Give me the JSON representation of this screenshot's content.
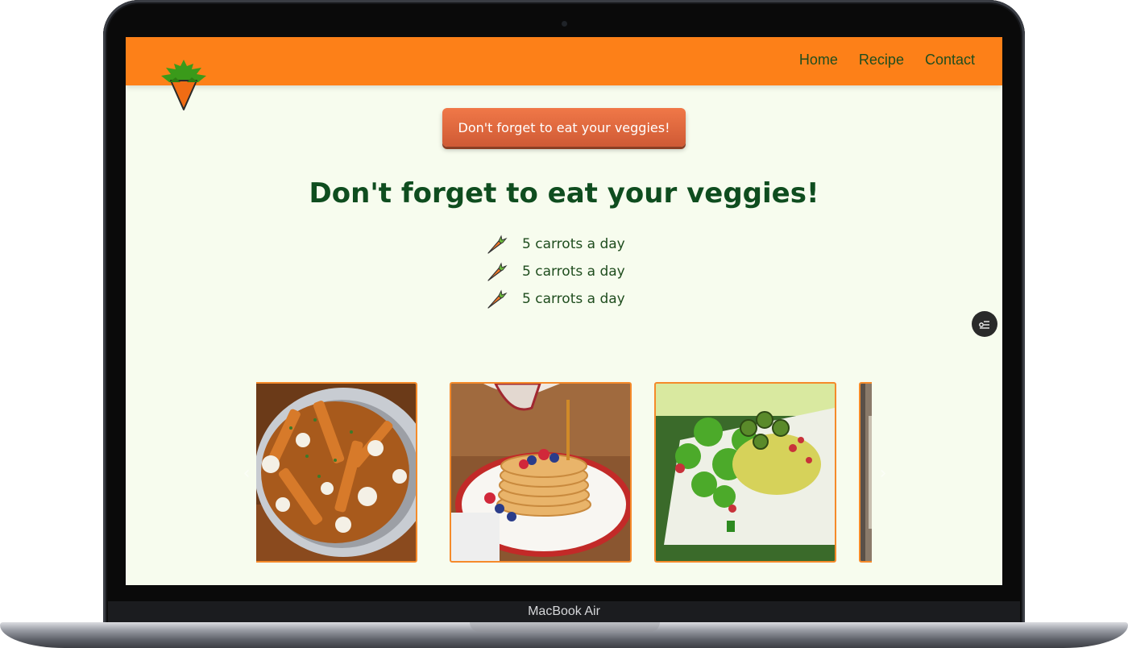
{
  "navbar": {
    "links": [
      {
        "label": "Home"
      },
      {
        "label": "Recipe"
      },
      {
        "label": "Contact"
      }
    ]
  },
  "hero": {
    "button_label": "Don't forget to eat your veggies!",
    "headline": "Don't forget to eat your veggies!",
    "list": [
      {
        "text": "5 carrots a day"
      },
      {
        "text": "5 carrots a day"
      },
      {
        "text": "5 carrots a day"
      }
    ]
  },
  "device": {
    "brand": "MacBook Air"
  },
  "colors": {
    "navbar": "#fd8018",
    "background": "#f7fcee",
    "heading": "#0f4d1f",
    "button": "#e06a3e",
    "card_border": "#f58a2a"
  },
  "icons": {
    "logo": "carrot-logo",
    "list_bullet": "carrot-icon",
    "fab": "filter-icon",
    "prev": "chevron-left-icon",
    "next": "chevron-right-icon"
  }
}
